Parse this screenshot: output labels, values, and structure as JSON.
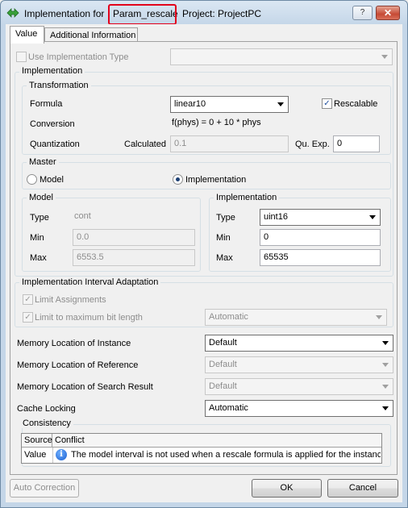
{
  "window": {
    "title_prefix": "Implementation for",
    "title_name": "Param_rescale",
    "title_project": "Project: ProjectPC",
    "help_button": "?",
    "close_button": "✕"
  },
  "tabs": [
    {
      "label": "Value"
    },
    {
      "label": "Additional Information"
    }
  ],
  "use_impl_type": {
    "label": "Use Implementation Type",
    "checked": false,
    "value": ""
  },
  "implementation_group": {
    "title": "Implementation"
  },
  "transformation": {
    "title": "Transformation",
    "formula_label": "Formula",
    "formula_value": "linear10",
    "rescalable_label": "Rescalable",
    "rescalable_checked": true,
    "conversion_label": "Conversion",
    "conversion_value": "f(phys) = 0 + 10 * phys",
    "quantization_label": "Quantization",
    "calculated_label": "Calculated",
    "calculated_value": "0.1",
    "qu_exp_label": "Qu. Exp.",
    "qu_exp_value": "0"
  },
  "master": {
    "title": "Master",
    "model_label": "Model",
    "implementation_label": "Implementation",
    "selected": "Implementation"
  },
  "model": {
    "title": "Model",
    "type_label": "Type",
    "type_value": "cont",
    "min_label": "Min",
    "min_value": "0.0",
    "max_label": "Max",
    "max_value": "6553.5"
  },
  "impl": {
    "title": "Implementation",
    "type_label": "Type",
    "type_value": "uint16",
    "min_label": "Min",
    "min_value": "0",
    "max_label": "Max",
    "max_value": "65535"
  },
  "interval_adaptation": {
    "title": "Implementation Interval Adaptation",
    "limit_assignments_label": "Limit Assignments",
    "limit_max_bit_label": "Limit to maximum bit length",
    "limit_max_bit_value": "Automatic"
  },
  "memory": {
    "instance_label": "Memory Location of Instance",
    "instance_value": "Default",
    "reference_label": "Memory Location of Reference",
    "reference_value": "Default",
    "search_label": "Memory Location of Search Result",
    "search_value": "Default",
    "cache_label": "Cache Locking",
    "cache_value": "Automatic"
  },
  "consistency": {
    "title": "Consistency",
    "columns": [
      "Source",
      "Conflict"
    ],
    "rows": [
      {
        "source": "Value",
        "icon": "info-icon",
        "conflict": "The model interval is not used when a rescale formula is applied for the instance"
      }
    ]
  },
  "buttons": {
    "auto_correction": "Auto Correction",
    "ok": "OK",
    "cancel": "Cancel"
  },
  "colors": {
    "highlight": "#e3001b",
    "info": "#1a5fd0"
  }
}
